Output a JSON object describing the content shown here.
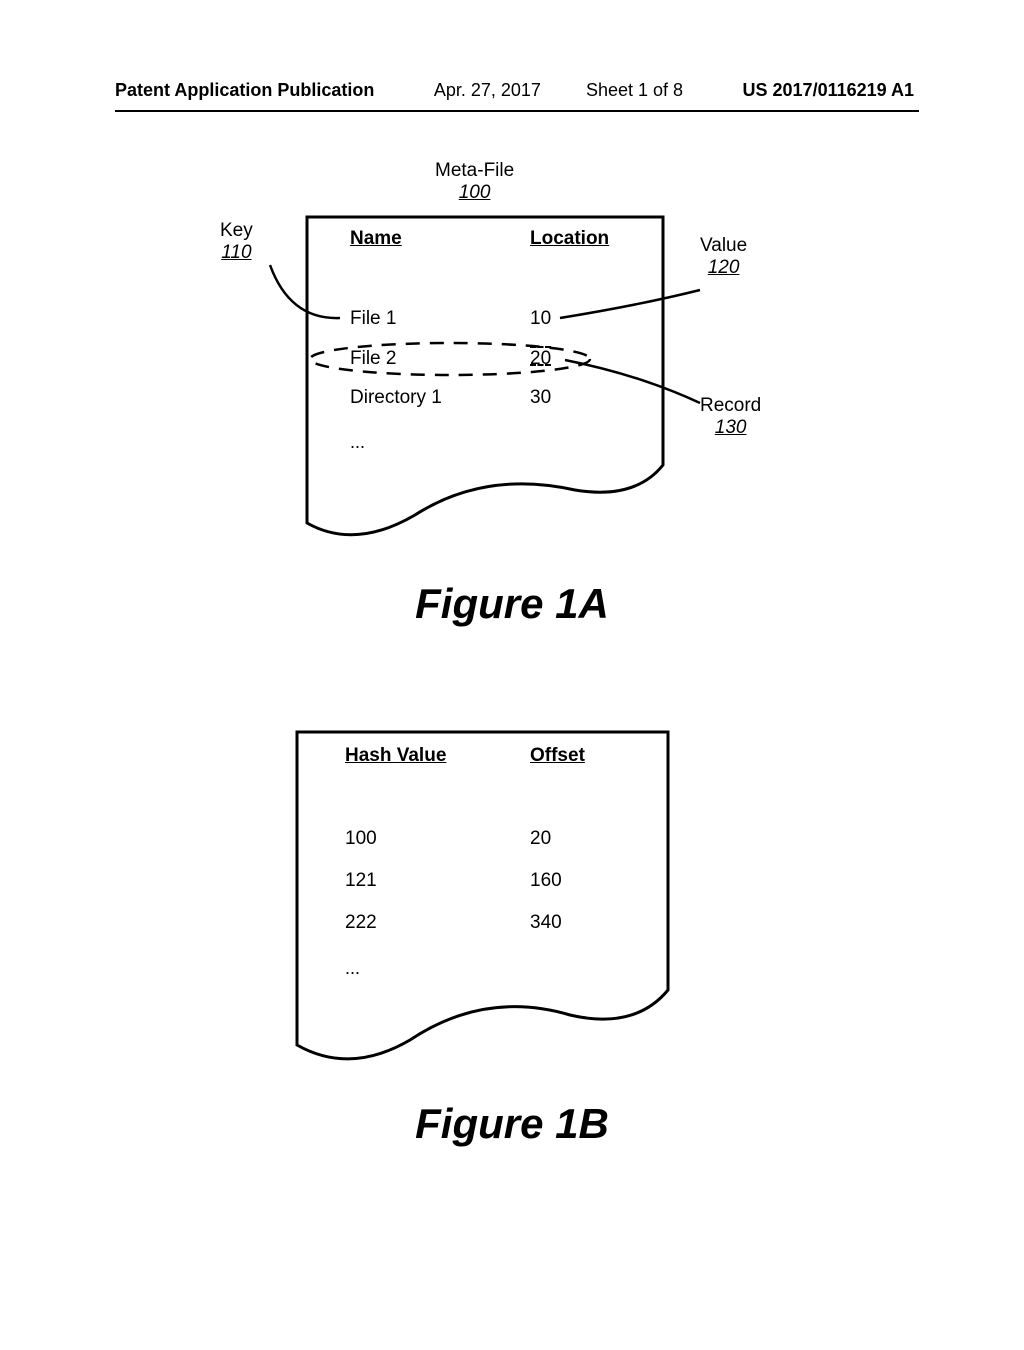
{
  "header": {
    "pub_label": "Patent Application Publication",
    "date": "Apr. 27, 2017",
    "sheet": "Sheet 1 of 8",
    "pub_no": "US 2017/0116219 A1"
  },
  "figure_a": {
    "title": "Meta-File",
    "title_ref": "100",
    "key_label": "Key",
    "key_ref": "110",
    "value_label": "Value",
    "value_ref": "120",
    "record_label": "Record",
    "record_ref": "130",
    "headers": {
      "name": "Name",
      "location": "Location"
    },
    "rows": [
      {
        "name": "File 1",
        "location": "10"
      },
      {
        "name": "File 2",
        "location": "20"
      },
      {
        "name": "Directory 1",
        "location": "30"
      },
      {
        "name": "...",
        "location": ""
      }
    ],
    "caption": "Figure 1A"
  },
  "figure_b": {
    "headers": {
      "hash": "Hash Value",
      "offset": "Offset"
    },
    "rows": [
      {
        "hash": "100",
        "offset": "20"
      },
      {
        "hash": "121",
        "offset": "160"
      },
      {
        "hash": "222",
        "offset": "340"
      },
      {
        "hash": "...",
        "offset": ""
      }
    ],
    "caption": "Figure 1B"
  }
}
